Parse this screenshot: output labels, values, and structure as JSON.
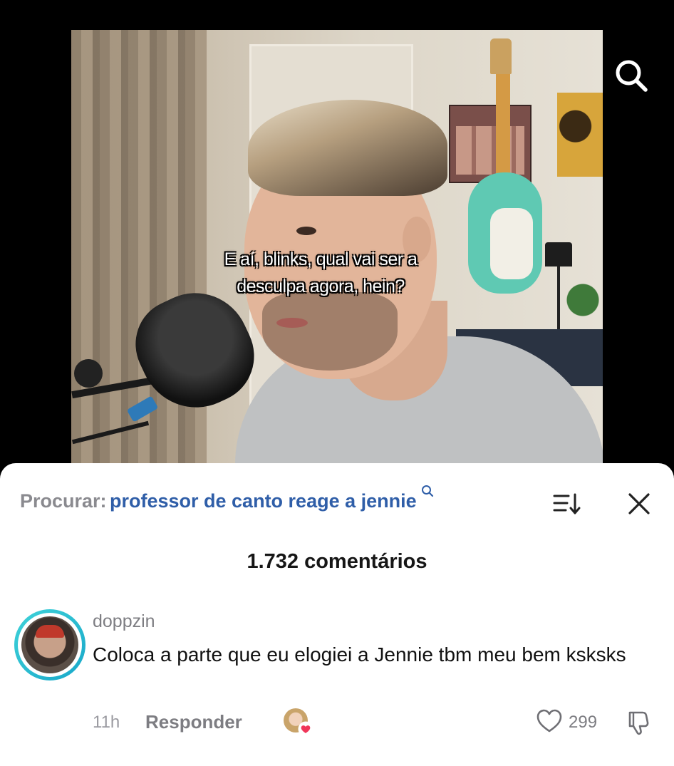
{
  "video": {
    "caption_line1": "E aí, blinks, qual vai ser a",
    "caption_line2": "desculpa agora, hein?"
  },
  "icons": {
    "top_search": "search-icon",
    "sort": "sort-icon",
    "close": "close-icon",
    "like": "heart-outline-icon",
    "dislike": "thumbs-down-icon"
  },
  "comments_panel": {
    "search_prefix": "Procurar:",
    "search_query": "professor de canto reage a jennie",
    "count_label": "1.732 comentários",
    "accent_color": "#2f5ea8"
  },
  "comment": {
    "username": "doppzin",
    "text": "Coloca a parte que eu elogiei a Jennie tbm meu bem ksksks",
    "time": "11h",
    "reply_label": "Responder",
    "like_count": "299",
    "liked_by_creator": true
  }
}
